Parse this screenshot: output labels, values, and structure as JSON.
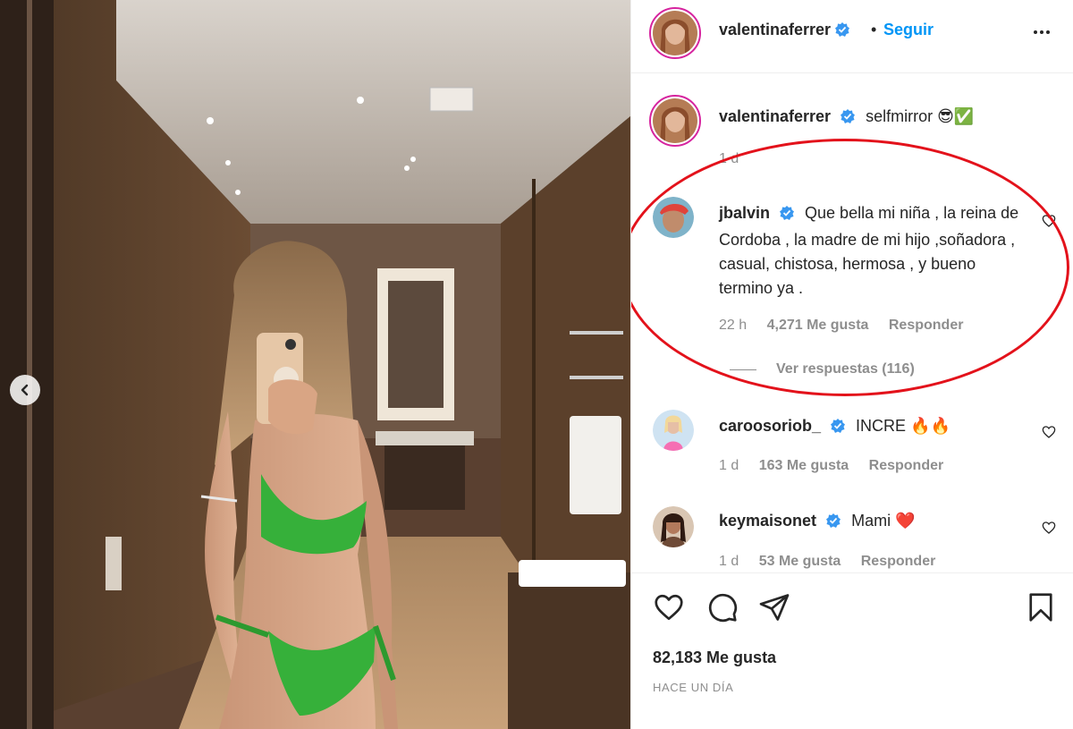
{
  "header": {
    "username": "valentinaferrer",
    "follow_separator": "•",
    "follow_label": "Seguir",
    "more_icon": "more-horizontal-icon"
  },
  "caption": {
    "username": "valentinaferrer",
    "text": "selfmirror 😎✅",
    "time": "1 d"
  },
  "comments": [
    {
      "username": "jbalvin",
      "text": "Que bella mi niña , la reina de Cordoba , la madre de mi hijo ,soñadora , casual, chistosa, hermosa , y bueno termino ya .",
      "time": "22 h",
      "likes": "4,271 Me gusta",
      "reply": "Responder",
      "view_replies": "Ver respuestas (116)"
    },
    {
      "username": "caroosoriob_",
      "text": "INCRE 🔥🔥",
      "time": "1 d",
      "likes": "163 Me gusta",
      "reply": "Responder"
    },
    {
      "username": "keymaisonet",
      "text": "Mami ❤️",
      "time": "1 d",
      "likes": "53 Me gusta",
      "reply": "Responder"
    }
  ],
  "actions": {
    "likes": "82,183 Me gusta",
    "timestamp": "HACE UN DÍA"
  },
  "colors": {
    "accent": "#0095f6",
    "verified": "#3897f0",
    "highlight_ellipse": "#e3121b",
    "muted": "#8e8e8e"
  }
}
